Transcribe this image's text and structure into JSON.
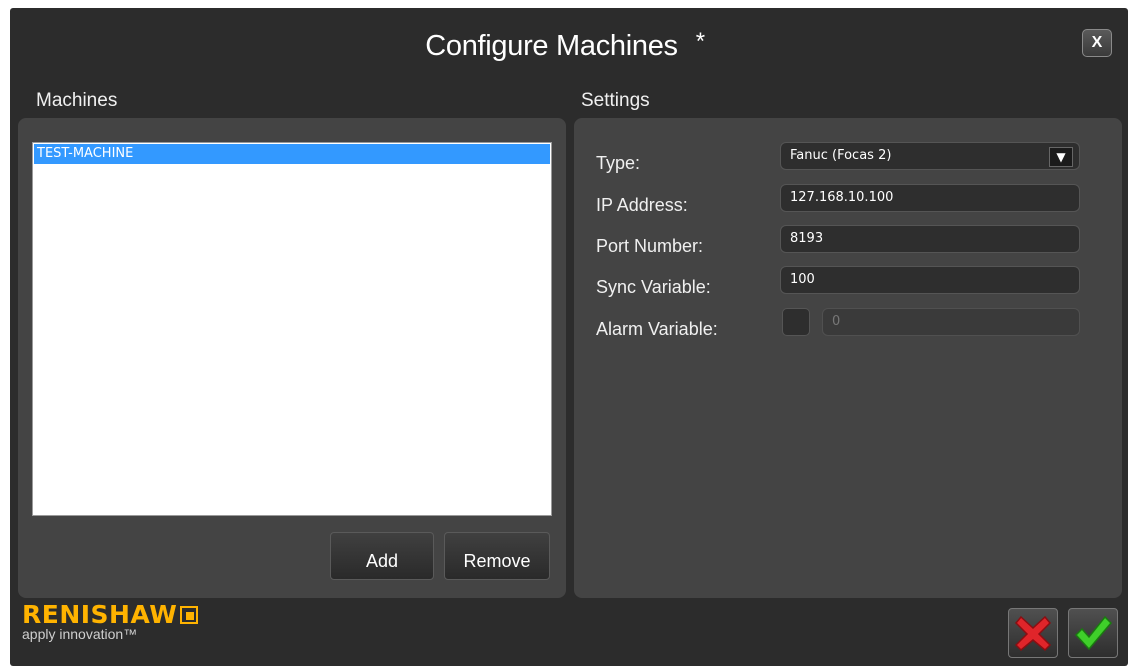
{
  "dialog": {
    "title": "Configure Machines",
    "unsaved_marker": "*",
    "close_label": "X"
  },
  "machines": {
    "heading": "Machines",
    "items": [
      {
        "label": "TEST-MACHINE",
        "selected": true
      }
    ],
    "add_label": "Add",
    "remove_label": "Remove"
  },
  "settings": {
    "heading": "Settings",
    "type": {
      "label": "Type:",
      "value": "Fanuc (Focas 2)"
    },
    "ip_address": {
      "label": "IP Address:",
      "value": "127.168.10.100"
    },
    "port_number": {
      "label": "Port Number:",
      "value": "8193"
    },
    "sync_variable": {
      "label": "Sync Variable:",
      "value": "100"
    },
    "alarm_variable": {
      "label": "Alarm Variable:",
      "enabled": false,
      "value": "0"
    }
  },
  "branding": {
    "name": "RENISHAW",
    "tagline": "apply innovation™",
    "color": "#ffb300"
  },
  "footer": {
    "cancel_icon": "red-x-icon",
    "confirm_icon": "green-check-icon"
  }
}
